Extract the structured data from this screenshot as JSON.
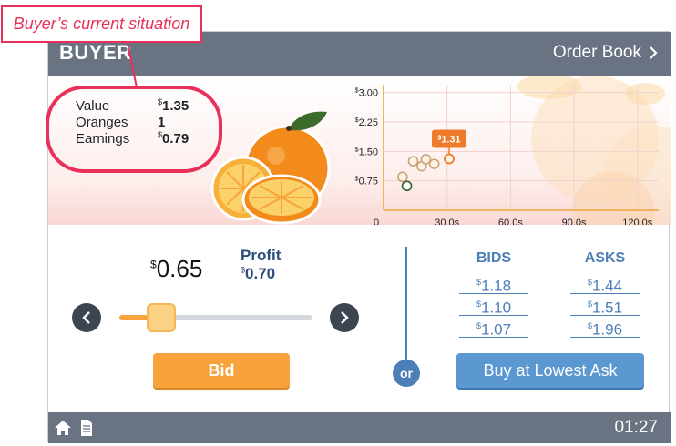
{
  "annotation": {
    "label": "Buyer’s current situation"
  },
  "header": {
    "role": "BUYER",
    "order_book_label": "Order Book"
  },
  "stats": {
    "value_label": "Value",
    "value_sup": "$",
    "value_amount": "1.35",
    "oranges_label": "Oranges",
    "oranges_value": "1",
    "earnings_label": "Earnings",
    "earnings_sup": "$",
    "earnings_amount": "0.79"
  },
  "chart_data": {
    "type": "scatter",
    "y_ticks": [
      {
        "sup": "$",
        "label": "3.00",
        "value": 3.0
      },
      {
        "sup": "$",
        "label": "2.25",
        "value": 2.25
      },
      {
        "sup": "$",
        "label": "1.50",
        "value": 1.5
      },
      {
        "sup": "$",
        "label": "0.75",
        "value": 0.75
      }
    ],
    "x_ticks": [
      {
        "label": "0",
        "value": 0
      },
      {
        "label": "30.0s",
        "value": 30
      },
      {
        "label": "60.0s",
        "value": 60
      },
      {
        "label": "90.0s",
        "value": 90
      },
      {
        "label": "120.0s",
        "value": 120
      }
    ],
    "xlim": [
      0,
      130
    ],
    "ylim": [
      0,
      3.2
    ],
    "grid": true,
    "points": [
      {
        "x": 9,
        "y": 0.85,
        "filled": false
      },
      {
        "x": 11,
        "y": 0.62,
        "filled": true
      },
      {
        "x": 14,
        "y": 1.25,
        "filled": false
      },
      {
        "x": 18,
        "y": 1.12,
        "filled": false
      },
      {
        "x": 20,
        "y": 1.3,
        "filled": false
      },
      {
        "x": 24,
        "y": 1.18,
        "filled": false
      },
      {
        "x": 31,
        "y": 1.31,
        "filled": false
      }
    ],
    "callout": {
      "sup": "$",
      "label": "1.31",
      "x": 31,
      "y": 1.31
    },
    "colors": {
      "axis": "#f0b35e",
      "grid": "#f3d1cc",
      "point": "#c9a37a",
      "callout": "#ee7b2b"
    }
  },
  "offer": {
    "price_sup": "$",
    "price_value": "0.65",
    "profit_label": "Profit",
    "profit_sup": "$",
    "profit_value": "0.70"
  },
  "slider": {
    "fill_fraction": 0.18
  },
  "actions": {
    "bid_label": "Bid",
    "or_label": "or",
    "buy_label": "Buy at Lowest Ask"
  },
  "book": {
    "bids_label": "BIDS",
    "asks_label": "ASKS",
    "bids": [
      {
        "sup": "$",
        "value": "1.18"
      },
      {
        "sup": "$",
        "value": "1.10"
      },
      {
        "sup": "$",
        "value": "1.07"
      }
    ],
    "asks": [
      {
        "sup": "$",
        "value": "1.44"
      },
      {
        "sup": "$",
        "value": "1.51"
      },
      {
        "sup": "$",
        "value": "1.96"
      }
    ]
  },
  "footer": {
    "timer": "01:27"
  },
  "colors": {
    "header": "#6a7382",
    "accent_orange": "#f7a23a",
    "accent_blue": "#4c7fb8",
    "callout": "#e8305a"
  }
}
